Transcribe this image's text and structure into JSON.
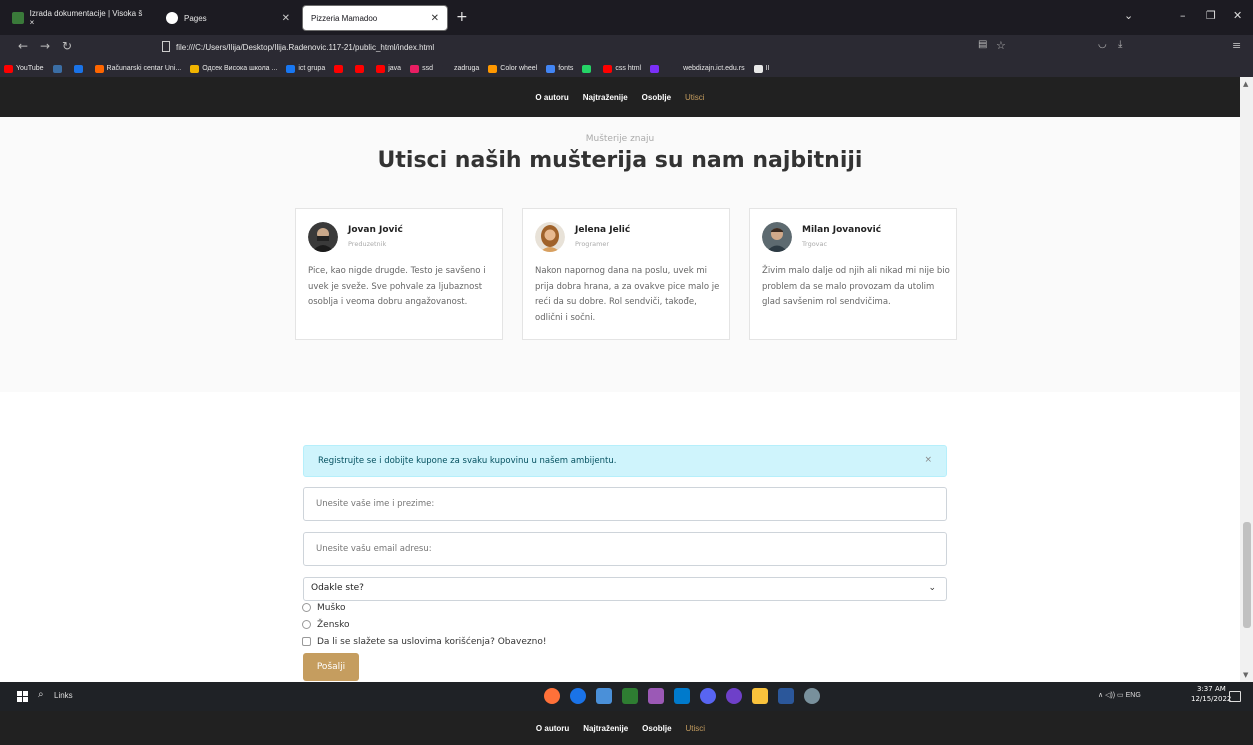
{
  "browser": {
    "tabs": [
      {
        "label": "Izrada dokumentacije | Visoka š ×"
      },
      {
        "label": "Pages"
      },
      {
        "label": "Pizzeria Mamadoo"
      }
    ],
    "url": "file:///C:/Users/Ilija/Desktop/Ilija.Radenovic.117-21/public_html/index.html",
    "bookmarks": [
      {
        "label": "YouTube",
        "color": "#ff0000"
      },
      {
        "label": "",
        "color": "#3b6ea5"
      },
      {
        "label": "",
        "color": "#1a73e8"
      },
      {
        "label": "Računarski centar Uni...",
        "color": "#ff6600"
      },
      {
        "label": "Одсек Висока школа ...",
        "color": "#f0b400"
      },
      {
        "label": "ict grupa",
        "color": "#1877f2"
      },
      {
        "label": "",
        "color": "#ff0000"
      },
      {
        "label": "",
        "color": "#ff0000"
      },
      {
        "label": "java",
        "color": "#ff0000"
      },
      {
        "label": "ssd",
        "color": "#e91e63"
      },
      {
        "label": "zadruga",
        "color": "#2b2a33"
      },
      {
        "label": "Color wheel",
        "color": "#ff9800"
      },
      {
        "label": "fonts",
        "color": "#4285f4"
      },
      {
        "label": "",
        "color": "#25d366"
      },
      {
        "label": "css html",
        "color": "#ff0000"
      },
      {
        "label": "",
        "color": "#7b2ff7"
      },
      {
        "label": "webdizajn.ict.edu.rs",
        "color": "#2b2a33"
      },
      {
        "label": "II",
        "color": "#e8e8e8"
      }
    ]
  },
  "site_nav": {
    "items": [
      "O autoru",
      "Najtraženije",
      "Osoblje",
      "Utisci"
    ],
    "active": "Utisci"
  },
  "testimonials": {
    "subtitle": "Mušterije znaju",
    "title": "Utisci naših mušterija su nam najbitniji",
    "cards": [
      {
        "name": "Jovan Jović",
        "role": "Preduzetnik",
        "text": "Pice, kao nigde drugde. Testo je savšeno i uvek je sveže. Sve pohvale za ljubaznost osoblja i veoma dobru angažovanost."
      },
      {
        "name": "Jelena Jelić",
        "role": "Programer",
        "text": "Nakon napornog dana na poslu, uvek mi prija dobra hrana, a za ovakve pice malo je reći da su dobre. Rol sendviči, takođe, odlični i sočni."
      },
      {
        "name": "Milan Jovanović",
        "role": "Trgovac",
        "text": "Živim malo dalje od njih ali nikad mi nije bio problem da se malo provozam da utolim glad savšenim rol sendvičima."
      }
    ]
  },
  "form": {
    "alert": "Registrujte se i dobijte kupone za svaku kupovinu u našem ambijentu.",
    "alert_close": "×",
    "name_placeholder": "Unesite vaše ime i prezime:",
    "email_placeholder": "Unesite vašu email adresu:",
    "select_value": "Odakle ste?",
    "radio_male": "Muško",
    "radio_female": "Žensko",
    "terms": "Da li se slažete sa uslovima korišćenja? Obavezno!",
    "submit": "Pošalji"
  },
  "taskbar": {
    "search": "Links",
    "tray": "∧  ◁))  ▭  ENG",
    "time": "3:37 AM",
    "date": "12/15/2022"
  }
}
